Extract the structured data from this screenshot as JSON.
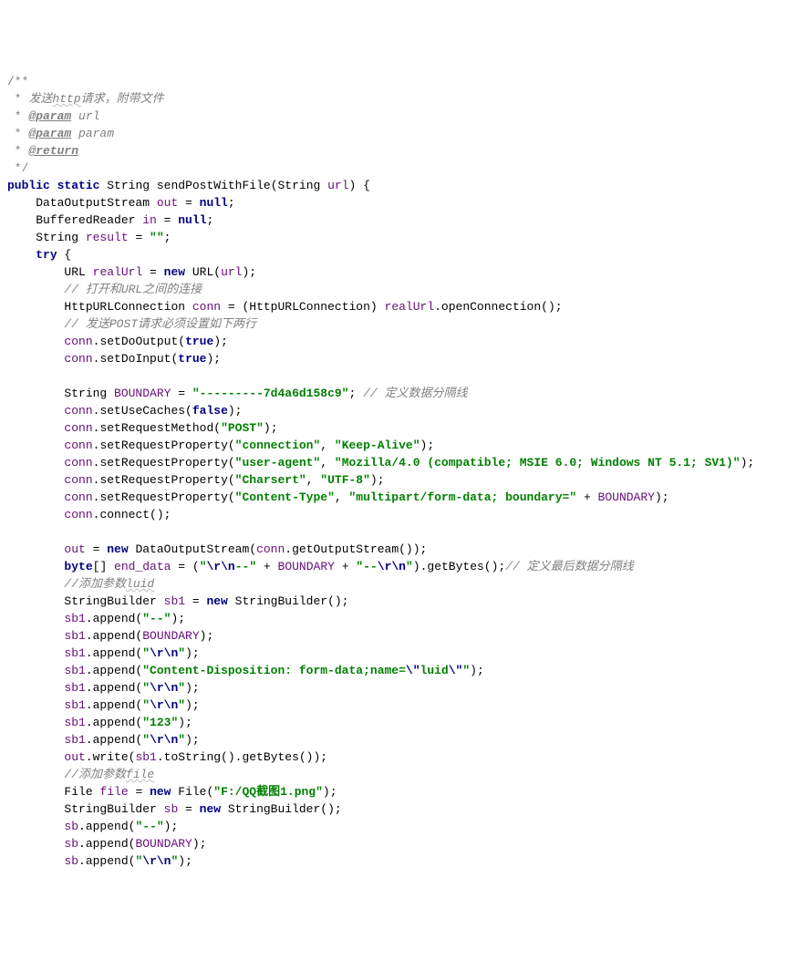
{
  "doc": {
    "open": "/**",
    "line1_star": " * ",
    "line1_text": "发送",
    "line1_http": "http",
    "line1_tail": "请求，附带文件",
    "param1_star": " * ",
    "param1_tag": "@param",
    "param1_name": " url",
    "param2_star": " * ",
    "param2_tag": "@param",
    "param2_name": " param",
    "return_star": " * ",
    "return_tag": "@return",
    "close": " */"
  },
  "kw": {
    "public": "public",
    "static": "static",
    "try": "try",
    "new": "new",
    "null": "null",
    "true": "true",
    "false": "false",
    "byte": "byte"
  },
  "sig": {
    "ret_type": " String ",
    "method": "sendPostWithFile",
    "open": "(String ",
    "param": "url",
    "close": ") {"
  },
  "decl": {
    "d1_a": "    DataOutputStream ",
    "d1_v": "out",
    "d1_b": " = ",
    "d1_c": ";",
    "d2_a": "    BufferedReader ",
    "d2_v": "in",
    "d2_b": " = ",
    "d2_c": ";",
    "d3_a": "    String ",
    "d3_v": "result",
    "d3_b": " = ",
    "d3_s": "\"\"",
    "d3_c": ";"
  },
  "trybody": {
    "indent4": "    ",
    "indent8": "        ",
    "u1_a": "URL ",
    "u1_v": "realUrl",
    "u1_b": " = ",
    "u1_c": " URL(",
    "u1_arg": "url",
    "u1_d": ");",
    "c_open_conn": "// 打开和URL之间的连接",
    "h1_a": "HttpURLConnection ",
    "h1_v": "conn",
    "h1_b": " = (HttpURLConnection) ",
    "h1_c": "realUrl",
    "h1_d": ".openConnection();",
    "c_post_two": "// 发送POST请求必须设置如下两行",
    "doout_a": "conn",
    "doout_b": ".setDoOutput(",
    "doout_c": ");",
    "doin_a": "conn",
    "doin_b": ".setDoInput(",
    "doin_c": ");",
    "bnd_a": "String ",
    "bnd_v": "BOUNDARY",
    "bnd_b": " = ",
    "bnd_s": "\"---------7d4a6d158c9\"",
    "bnd_c": "; ",
    "bnd_cm": "// 定义数据分隔线",
    "cache_a": "conn",
    "cache_b": ".setUseCaches(",
    "cache_c": ");",
    "rm_a": "conn",
    "rm_b": ".setRequestMethod(",
    "rm_s": "\"POST\"",
    "rm_c": ");",
    "rp1_a": "conn",
    "rp1_b": ".setRequestProperty(",
    "rp1_s1": "\"connection\"",
    "rp1_m": ", ",
    "rp1_s2": "\"Keep-Alive\"",
    "rp1_c": ");",
    "rp2_a": "conn",
    "rp2_b": ".setRequestProperty(",
    "rp2_s1": "\"user-agent\"",
    "rp2_m": ", ",
    "rp2_s2": "\"Mozilla/4.0 (compatible; MSIE 6.0; Windows NT 5.1; SV1)\"",
    "rp2_c": ");",
    "rp3_a": "conn",
    "rp3_b": ".setRequestProperty(",
    "rp3_s1": "\"Charsert\"",
    "rp3_m": ", ",
    "rp3_s2": "\"UTF-8\"",
    "rp3_c": ");",
    "rp4_a": "conn",
    "rp4_b": ".setRequestProperty(",
    "rp4_s1": "\"Content-Type\"",
    "rp4_m": ", ",
    "rp4_s2": "\"multipart/form-data; boundary=\"",
    "rp4_plus": " + ",
    "rp4_v": "BOUNDARY",
    "rp4_c": ");",
    "connc_a": "conn",
    "connc_b": ".connect();",
    "out_a": "out",
    "out_b": " = ",
    "out_c": " DataOutputStream(",
    "out_v": "conn",
    "out_d": ".getOutputStream());",
    "end_a": "[] ",
    "end_v": "end_data",
    "end_b": " = (",
    "end_s1a": "\"",
    "end_s1b": "\\r\\n",
    "end_s1c": "--\"",
    "end_p1": " + ",
    "end_vb": "BOUNDARY",
    "end_p2": " + ",
    "end_s2a": "\"--",
    "end_s2b": "\\r\\n",
    "end_s2c": "\"",
    "end_c": ").getBytes();",
    "end_cm": "// 定义最后数据分隔线",
    "cm_luid_a": "//添加参数",
    "cm_luid_b": "luid",
    "sb1_a": "StringBuilder ",
    "sb1_v": "sb1",
    "sb1_b": " = ",
    "sb1_c": " StringBuilder();",
    "ap_a": "sb1",
    "ap_b": ".append(",
    "ap_close": ");",
    "s_dd": "\"--\"",
    "s_rn_a": "\"",
    "s_rn_b": "\\r\\n",
    "s_rn_c": "\"",
    "s_cd_a": "\"Content-Disposition: form-data;name=",
    "s_cd_b": "\\\"",
    "s_cd_c": "luid",
    "s_cd_d": "\\\"",
    "s_cd_e": "\"",
    "s_123": "\"123\"",
    "ow_a": "out",
    "ow_b": ".write(",
    "ow_v": "sb1",
    "ow_c": ".toString().getBytes());",
    "cm_file_a": "//添加参数",
    "cm_file_b": "file",
    "file_a": "File ",
    "file_v": "file",
    "file_b": " = ",
    "file_c": " File(",
    "file_s": "\"F:/QQ截图1.png\"",
    "file_d": ");",
    "sb_a": "StringBuilder ",
    "sb_v": "sb",
    "sb_b": " = ",
    "sb_c": " StringBuilder();",
    "apb_a": "sb",
    "apb_b": ".append("
  }
}
